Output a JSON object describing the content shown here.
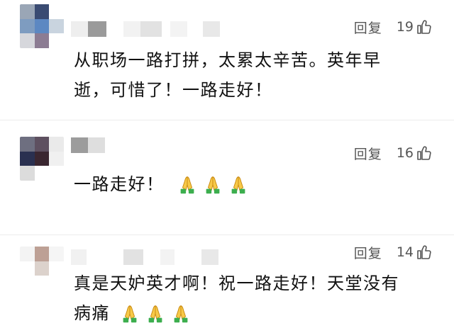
{
  "comments": [
    {
      "reply_label": "回复",
      "like_count": "19",
      "text_line1": "从职场一路打拼，太累太辛苦。英年早",
      "text_line2": "逝，可惜了！一路走好！",
      "emoji_count": 0
    },
    {
      "reply_label": "回复",
      "like_count": "16",
      "text_line1": "一路走好！",
      "emoji": "folded-hands",
      "emoji_count": 3
    },
    {
      "reply_label": "回复",
      "like_count": "14",
      "text_line1": "真是天妒英才啊！祝一路走好！天堂没有",
      "text_line2": "病痛",
      "emoji": "folded-hands",
      "emoji_count": 3
    }
  ],
  "icons": {
    "like": "thumbs-up-icon",
    "emoji": "folded-hands-icon"
  },
  "colors": {
    "text": "#111111",
    "secondary": "#555555",
    "divider": "#ececec"
  }
}
